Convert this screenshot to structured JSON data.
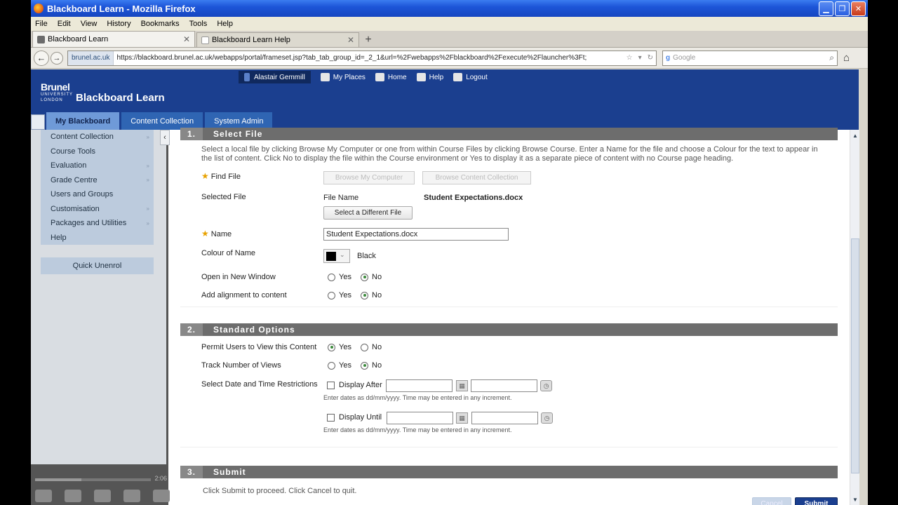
{
  "window": {
    "title": "Blackboard Learn - Mozilla Firefox"
  },
  "menu": [
    "File",
    "Edit",
    "View",
    "History",
    "Bookmarks",
    "Tools",
    "Help"
  ],
  "tabs": [
    {
      "label": "Blackboard Learn"
    },
    {
      "label": "Blackboard Learn Help"
    }
  ],
  "nav": {
    "site": "brunel.ac.uk",
    "url": "https://blackboard.brunel.ac.uk/webapps/portal/frameset.jsp?tab_tab_group_id=_2_1&url=%2Fwebapps%2Fblackboard%2Fexecute%2Flauncher%3Ft;",
    "search_placeholder": "Google"
  },
  "bb": {
    "logo": {
      "brunel": "Brunel",
      "university": "UNIVERSITY",
      "london": "LONDON",
      "product": "Blackboard Learn"
    },
    "topnav": {
      "user": "Alastair Gemmill",
      "my_places": "My Places",
      "home": "Home",
      "help": "Help",
      "logout": "Logout"
    },
    "tabs": [
      "My Blackboard",
      "Content Collection",
      "System Admin"
    ]
  },
  "sidebar": {
    "items": [
      "Content Collection",
      "Course Tools",
      "Evaluation",
      "Grade Centre",
      "Users and Groups",
      "Customisation",
      "Packages and Utilities",
      "Help"
    ],
    "quick_unenrol": "Quick Unenrol",
    "player_time": "2:06"
  },
  "form": {
    "section1": {
      "num": "1.",
      "title": "Select File",
      "instructions": "Select a local file by clicking Browse My Computer or one from within Course Files by clicking Browse Course. Enter a Name for the file and choose a Colour for the text to appear in the list of content. Click No to display the file within the Course environment or Yes to display it as a separate piece of content with no Course page heading.",
      "find_file": "Find File",
      "browse_computer": "Browse My Computer",
      "browse_collection": "Browse Content Collection",
      "selected_file": "Selected File",
      "file_name_label": "File Name",
      "file_name": "Student Expectations.docx",
      "select_different": "Select a Different File",
      "name_label": "Name",
      "name_value": "Student Expectations.docx",
      "colour_label": "Colour of Name",
      "colour_value": "Black",
      "open_new_window": "Open in New Window",
      "align_content": "Add alignment to content",
      "yes": "Yes",
      "no": "No"
    },
    "section2": {
      "num": "2.",
      "title": "Standard Options",
      "permit": "Permit Users to View this Content",
      "track": "Track Number of Views",
      "date_restrict": "Select Date and Time Restrictions",
      "display_after": "Display After",
      "display_until": "Display Until",
      "hint": "Enter dates as dd/mm/yyyy. Time may be entered in any increment."
    },
    "section3": {
      "num": "3.",
      "title": "Submit",
      "text": "Click Submit to proceed. Click Cancel to quit.",
      "cancel": "Cancel",
      "submit": "Submit"
    }
  }
}
